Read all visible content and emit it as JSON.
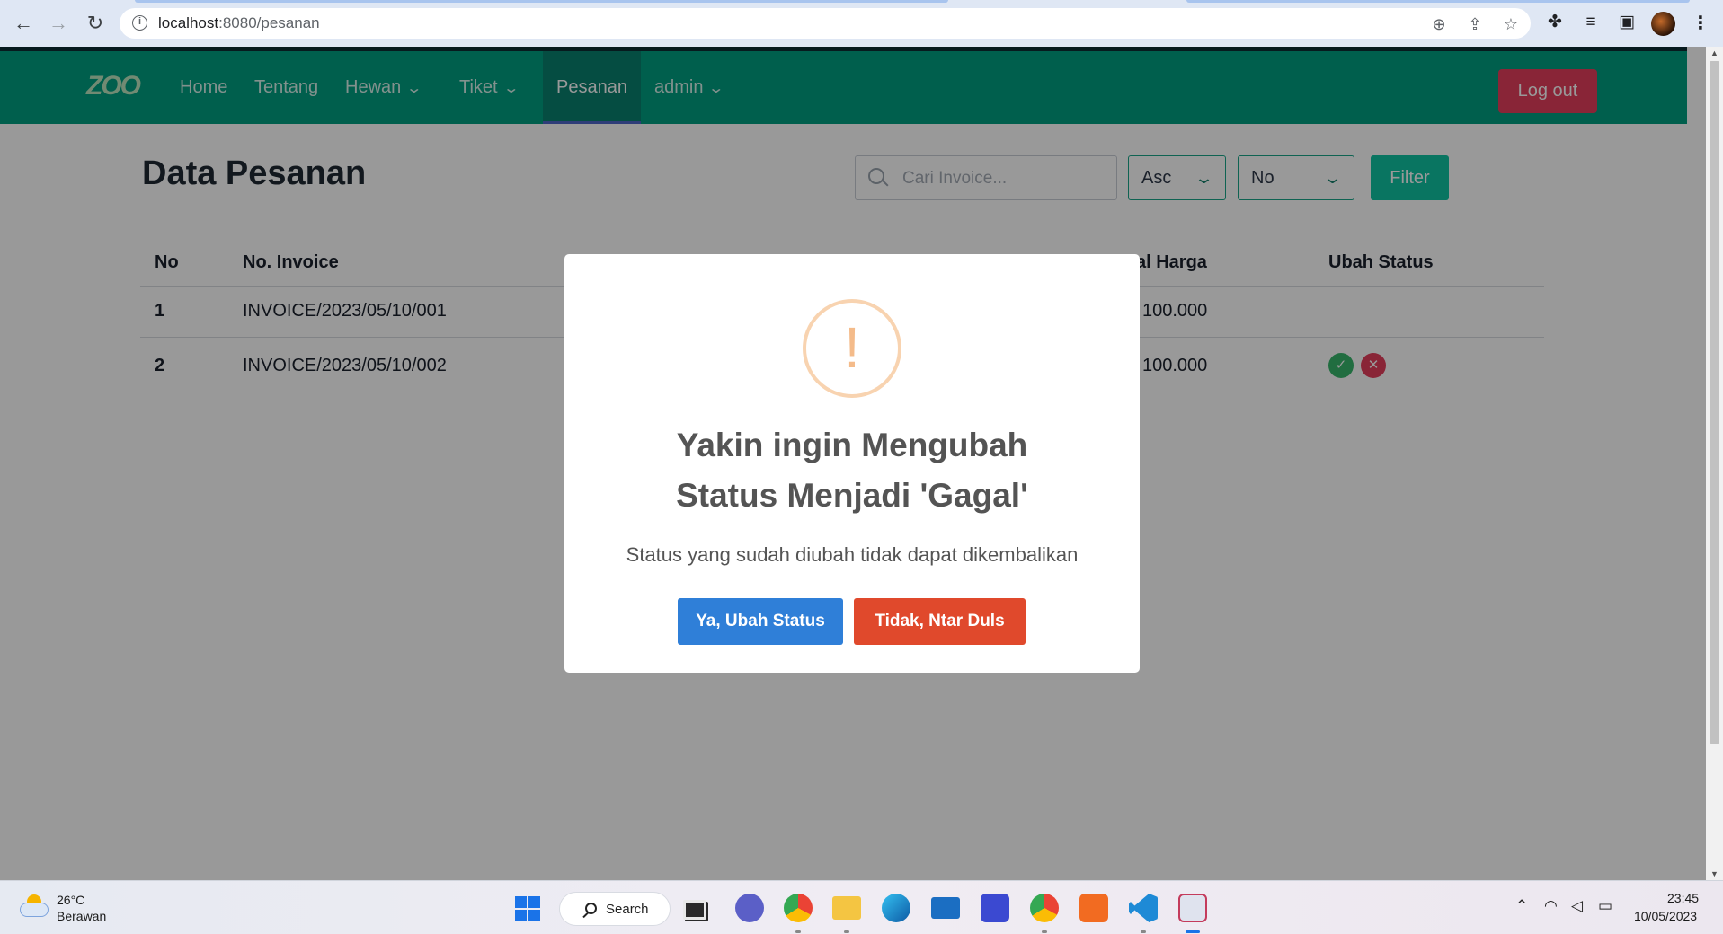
{
  "browser": {
    "url_host": "localhost",
    "url_path": ":8080/pesanan"
  },
  "navbar": {
    "logo": "ZOO",
    "items": [
      "Home",
      "Tentang",
      "Hewan",
      "Tiket",
      "Pesanan",
      "admin"
    ],
    "active": "Pesanan",
    "logout_label": "Log out",
    "brand_color": "#019e80"
  },
  "main": {
    "title": "Data Pesanan",
    "search_placeholder": "Cari Invoice...",
    "sort_value": "Asc",
    "sort_field_value": "No",
    "filter_label": "Filter"
  },
  "table": {
    "columns": [
      "No",
      "No. Invoice",
      "al Harga",
      "Ubah Status"
    ],
    "rows": [
      {
        "no": "1",
        "invoice": "INVOICE/2023/05/10/001",
        "harga": "100.000"
      },
      {
        "no": "2",
        "invoice": "INVOICE/2023/05/10/002",
        "harga": "100.000"
      }
    ]
  },
  "modal": {
    "icon_glyph": "!",
    "title_line1": "Yakin ingin Mengubah",
    "title_line2": "Status Menjadi 'Gagal'",
    "text": "Status yang sudah diubah tidak dapat dikembalikan",
    "confirm_label": "Ya, Ubah Status",
    "cancel_label": "Tidak, Ntar Duls"
  },
  "taskbar": {
    "temperature": "26°C",
    "weather": "Berawan",
    "search_label": "Search",
    "time": "23:45",
    "date": "10/05/2023"
  }
}
